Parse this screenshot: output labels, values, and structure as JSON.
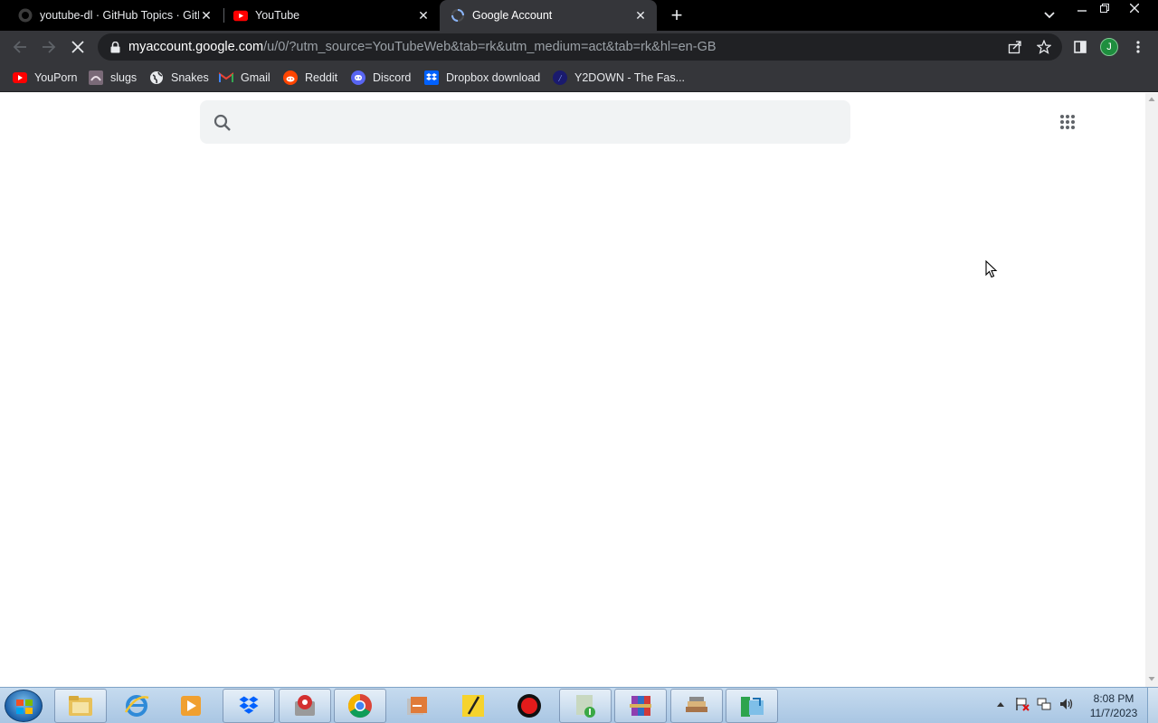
{
  "tabs": [
    {
      "title": "youtube-dl · GitHub Topics · GitH",
      "icon": "github-icon",
      "active": false
    },
    {
      "title": "YouTube",
      "icon": "youtube-icon",
      "active": false
    },
    {
      "title": "Google Account",
      "icon": "loading-spinner-icon",
      "active": true
    }
  ],
  "toolbar": {
    "url_host": "myaccount.google.com",
    "url_path": "/u/0/?utm_source=YouTubeWeb&tab=rk&utm_medium=act&tab=rk&hl=en-GB",
    "avatar_letter": "J"
  },
  "bookmarks": [
    {
      "label": "YouPorn",
      "icon": "youtube-red-icon"
    },
    {
      "label": "slugs",
      "icon": "slug-icon"
    },
    {
      "label": "Snakes",
      "icon": "globe-icon"
    },
    {
      "label": "Gmail",
      "icon": "gmail-icon"
    },
    {
      "label": "Reddit",
      "icon": "reddit-icon"
    },
    {
      "label": "Discord",
      "icon": "discord-icon"
    },
    {
      "label": "Dropbox download",
      "icon": "dropbox-icon"
    },
    {
      "label": "Y2DOWN - The Fas...",
      "icon": "y2down-icon"
    }
  ],
  "page": {
    "search_value": "",
    "search_placeholder": ""
  },
  "taskbar": {
    "apps": [
      "file-explorer",
      "internet-explorer",
      "media-player",
      "dropbox",
      "screenshot-tool",
      "chrome",
      "archive-tool",
      "pen-tool",
      "record",
      "downloader",
      "winrar",
      "books",
      "installer"
    ],
    "time": "8:08 PM",
    "date": "11/7/2023"
  },
  "colors": {
    "titlebar": "#000000",
    "toolbar": "#35363a",
    "omnibox": "#202124",
    "search_field": "#f1f3f4",
    "avatar": "#1e8e3e"
  }
}
